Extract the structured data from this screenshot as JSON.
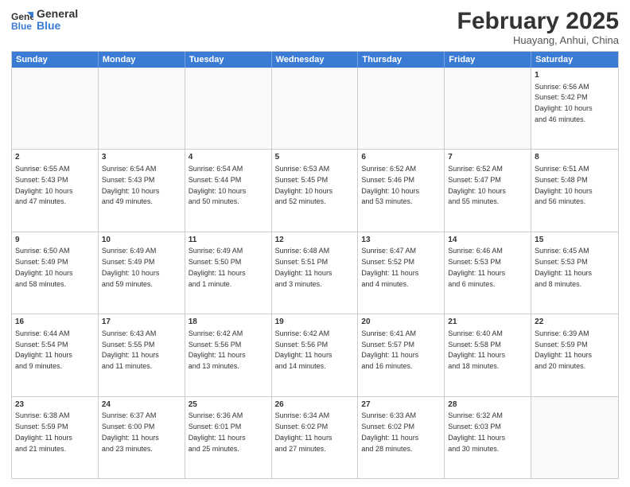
{
  "header": {
    "logo_line1": "General",
    "logo_line2": "Blue",
    "month_title": "February 2025",
    "location": "Huayang, Anhui, China"
  },
  "weekdays": [
    "Sunday",
    "Monday",
    "Tuesday",
    "Wednesday",
    "Thursday",
    "Friday",
    "Saturday"
  ],
  "rows": [
    [
      {
        "day": "",
        "info": ""
      },
      {
        "day": "",
        "info": ""
      },
      {
        "day": "",
        "info": ""
      },
      {
        "day": "",
        "info": ""
      },
      {
        "day": "",
        "info": ""
      },
      {
        "day": "",
        "info": ""
      },
      {
        "day": "1",
        "info": "Sunrise: 6:56 AM\nSunset: 5:42 PM\nDaylight: 10 hours\nand 46 minutes."
      }
    ],
    [
      {
        "day": "2",
        "info": "Sunrise: 6:55 AM\nSunset: 5:43 PM\nDaylight: 10 hours\nand 47 minutes."
      },
      {
        "day": "3",
        "info": "Sunrise: 6:54 AM\nSunset: 5:43 PM\nDaylight: 10 hours\nand 49 minutes."
      },
      {
        "day": "4",
        "info": "Sunrise: 6:54 AM\nSunset: 5:44 PM\nDaylight: 10 hours\nand 50 minutes."
      },
      {
        "day": "5",
        "info": "Sunrise: 6:53 AM\nSunset: 5:45 PM\nDaylight: 10 hours\nand 52 minutes."
      },
      {
        "day": "6",
        "info": "Sunrise: 6:52 AM\nSunset: 5:46 PM\nDaylight: 10 hours\nand 53 minutes."
      },
      {
        "day": "7",
        "info": "Sunrise: 6:52 AM\nSunset: 5:47 PM\nDaylight: 10 hours\nand 55 minutes."
      },
      {
        "day": "8",
        "info": "Sunrise: 6:51 AM\nSunset: 5:48 PM\nDaylight: 10 hours\nand 56 minutes."
      }
    ],
    [
      {
        "day": "9",
        "info": "Sunrise: 6:50 AM\nSunset: 5:49 PM\nDaylight: 10 hours\nand 58 minutes."
      },
      {
        "day": "10",
        "info": "Sunrise: 6:49 AM\nSunset: 5:49 PM\nDaylight: 10 hours\nand 59 minutes."
      },
      {
        "day": "11",
        "info": "Sunrise: 6:49 AM\nSunset: 5:50 PM\nDaylight: 11 hours\nand 1 minute."
      },
      {
        "day": "12",
        "info": "Sunrise: 6:48 AM\nSunset: 5:51 PM\nDaylight: 11 hours\nand 3 minutes."
      },
      {
        "day": "13",
        "info": "Sunrise: 6:47 AM\nSunset: 5:52 PM\nDaylight: 11 hours\nand 4 minutes."
      },
      {
        "day": "14",
        "info": "Sunrise: 6:46 AM\nSunset: 5:53 PM\nDaylight: 11 hours\nand 6 minutes."
      },
      {
        "day": "15",
        "info": "Sunrise: 6:45 AM\nSunset: 5:53 PM\nDaylight: 11 hours\nand 8 minutes."
      }
    ],
    [
      {
        "day": "16",
        "info": "Sunrise: 6:44 AM\nSunset: 5:54 PM\nDaylight: 11 hours\nand 9 minutes."
      },
      {
        "day": "17",
        "info": "Sunrise: 6:43 AM\nSunset: 5:55 PM\nDaylight: 11 hours\nand 11 minutes."
      },
      {
        "day": "18",
        "info": "Sunrise: 6:42 AM\nSunset: 5:56 PM\nDaylight: 11 hours\nand 13 minutes."
      },
      {
        "day": "19",
        "info": "Sunrise: 6:42 AM\nSunset: 5:56 PM\nDaylight: 11 hours\nand 14 minutes."
      },
      {
        "day": "20",
        "info": "Sunrise: 6:41 AM\nSunset: 5:57 PM\nDaylight: 11 hours\nand 16 minutes."
      },
      {
        "day": "21",
        "info": "Sunrise: 6:40 AM\nSunset: 5:58 PM\nDaylight: 11 hours\nand 18 minutes."
      },
      {
        "day": "22",
        "info": "Sunrise: 6:39 AM\nSunset: 5:59 PM\nDaylight: 11 hours\nand 20 minutes."
      }
    ],
    [
      {
        "day": "23",
        "info": "Sunrise: 6:38 AM\nSunset: 5:59 PM\nDaylight: 11 hours\nand 21 minutes."
      },
      {
        "day": "24",
        "info": "Sunrise: 6:37 AM\nSunset: 6:00 PM\nDaylight: 11 hours\nand 23 minutes."
      },
      {
        "day": "25",
        "info": "Sunrise: 6:36 AM\nSunset: 6:01 PM\nDaylight: 11 hours\nand 25 minutes."
      },
      {
        "day": "26",
        "info": "Sunrise: 6:34 AM\nSunset: 6:02 PM\nDaylight: 11 hours\nand 27 minutes."
      },
      {
        "day": "27",
        "info": "Sunrise: 6:33 AM\nSunset: 6:02 PM\nDaylight: 11 hours\nand 28 minutes."
      },
      {
        "day": "28",
        "info": "Sunrise: 6:32 AM\nSunset: 6:03 PM\nDaylight: 11 hours\nand 30 minutes."
      },
      {
        "day": "",
        "info": ""
      }
    ]
  ]
}
